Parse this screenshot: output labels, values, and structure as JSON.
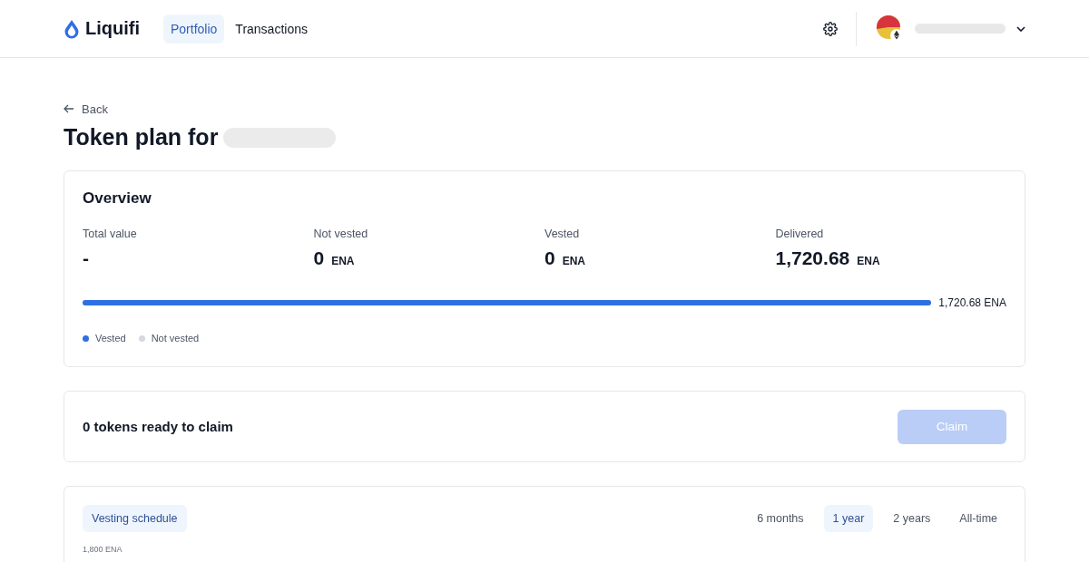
{
  "header": {
    "logo": "Liquifi",
    "nav": [
      {
        "label": "Portfolio",
        "selected": true
      },
      {
        "label": "Transactions",
        "selected": false
      }
    ]
  },
  "back": "Back",
  "title": "Token plan for",
  "overview": {
    "title": "Overview",
    "stats": [
      {
        "label": "Total value",
        "value": "-"
      },
      {
        "label": "Not vested",
        "value": "0",
        "unit": "ENA"
      },
      {
        "label": "Vested",
        "value": "0",
        "unit": "ENA"
      },
      {
        "label": "Delivered",
        "value": "1,720.68",
        "unit": "ENA"
      }
    ],
    "progress": {
      "level": 1,
      "reading": "1,720.68 ENA"
    },
    "legend": [
      {
        "label": "Vested",
        "color": "#2f6fe4"
      },
      {
        "label": "Not vested",
        "color": "#d5d9df"
      }
    ]
  },
  "claim": {
    "text": "0 tokens ready to claim",
    "button": "Claim",
    "disabled": true
  },
  "schedule": {
    "tab": {
      "label": "Vesting schedule",
      "selected": true
    },
    "periods": [
      {
        "label": "6 months",
        "selected": false
      },
      {
        "label": "1 year",
        "selected": true
      },
      {
        "label": "2 years",
        "selected": false
      },
      {
        "label": "All-time",
        "selected": false
      }
    ],
    "axis_label": "1,800 ENA"
  }
}
